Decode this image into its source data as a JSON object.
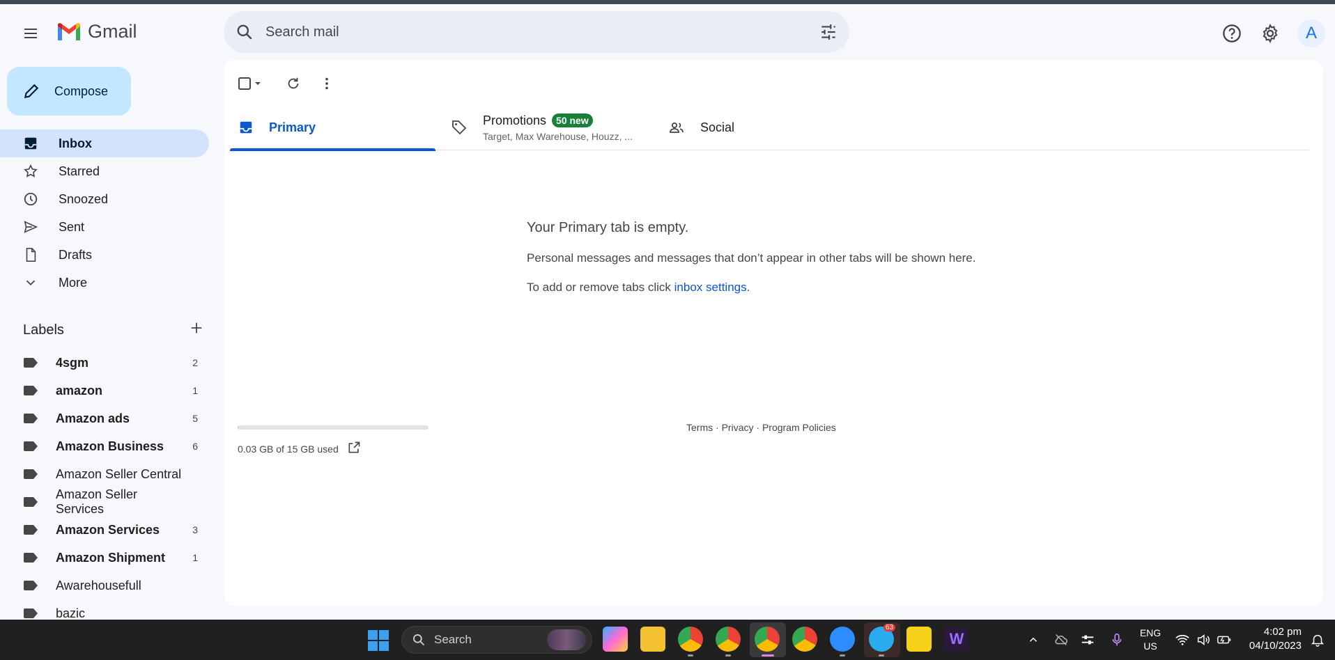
{
  "app": {
    "name": "Gmail"
  },
  "search": {
    "placeholder": "Search mail"
  },
  "header": {
    "avatar_letter": "A"
  },
  "compose": {
    "label": "Compose"
  },
  "nav": [
    {
      "label": "Inbox",
      "icon": "inbox-icon",
      "active": true
    },
    {
      "label": "Starred",
      "icon": "star-icon"
    },
    {
      "label": "Snoozed",
      "icon": "clock-icon"
    },
    {
      "label": "Sent",
      "icon": "send-icon"
    },
    {
      "label": "Drafts",
      "icon": "draft-icon"
    },
    {
      "label": "More",
      "icon": "chevron-down-icon"
    }
  ],
  "labels_section": {
    "title": "Labels"
  },
  "labels": [
    {
      "name": "4sgm",
      "count": "2",
      "bold": true
    },
    {
      "name": "amazon",
      "count": "1",
      "bold": true
    },
    {
      "name": "Amazon ads",
      "count": "5",
      "bold": true
    },
    {
      "name": "Amazon Business",
      "count": "6",
      "bold": true
    },
    {
      "name": "Amazon Seller Central",
      "count": "",
      "bold": false
    },
    {
      "name": "Amazon Seller Services",
      "count": "",
      "bold": false
    },
    {
      "name": "Amazon Services",
      "count": "3",
      "bold": true
    },
    {
      "name": "Amazon Shipment",
      "count": "1",
      "bold": true
    },
    {
      "name": "Awarehousefull",
      "count": "",
      "bold": false
    },
    {
      "name": "bazic",
      "count": "",
      "bold": false
    }
  ],
  "tabs": {
    "primary": "Primary",
    "promotions": "Promotions",
    "promotions_badge": "50 new",
    "promotions_senders": "Target, Max Warehouse, Houzz, ...",
    "social": "Social"
  },
  "empty_state": {
    "title": "Your Primary tab is empty.",
    "line1": "Personal messages and messages that don’t appear in other tabs will be shown here.",
    "line2_prefix": "To add or remove tabs click ",
    "line2_link": "inbox settings",
    "line2_suffix": "."
  },
  "storage": {
    "text": "0.03 GB of 15 GB used",
    "used_fraction": 0.002
  },
  "footer": {
    "terms": "Terms",
    "sep": " · ",
    "privacy": "Privacy",
    "policies": "Program Policies"
  },
  "taskbar": {
    "search_label": "Search",
    "lang_line1": "ENG",
    "lang_line2": "US",
    "time": "4:02 pm",
    "date": "04/10/2023",
    "telegram_badge": "63"
  },
  "colors": {
    "accent": "#0b57d0",
    "compose_bg": "#c2e7ff",
    "active_nav": "#d3e3fd",
    "badge_green": "#188038"
  }
}
